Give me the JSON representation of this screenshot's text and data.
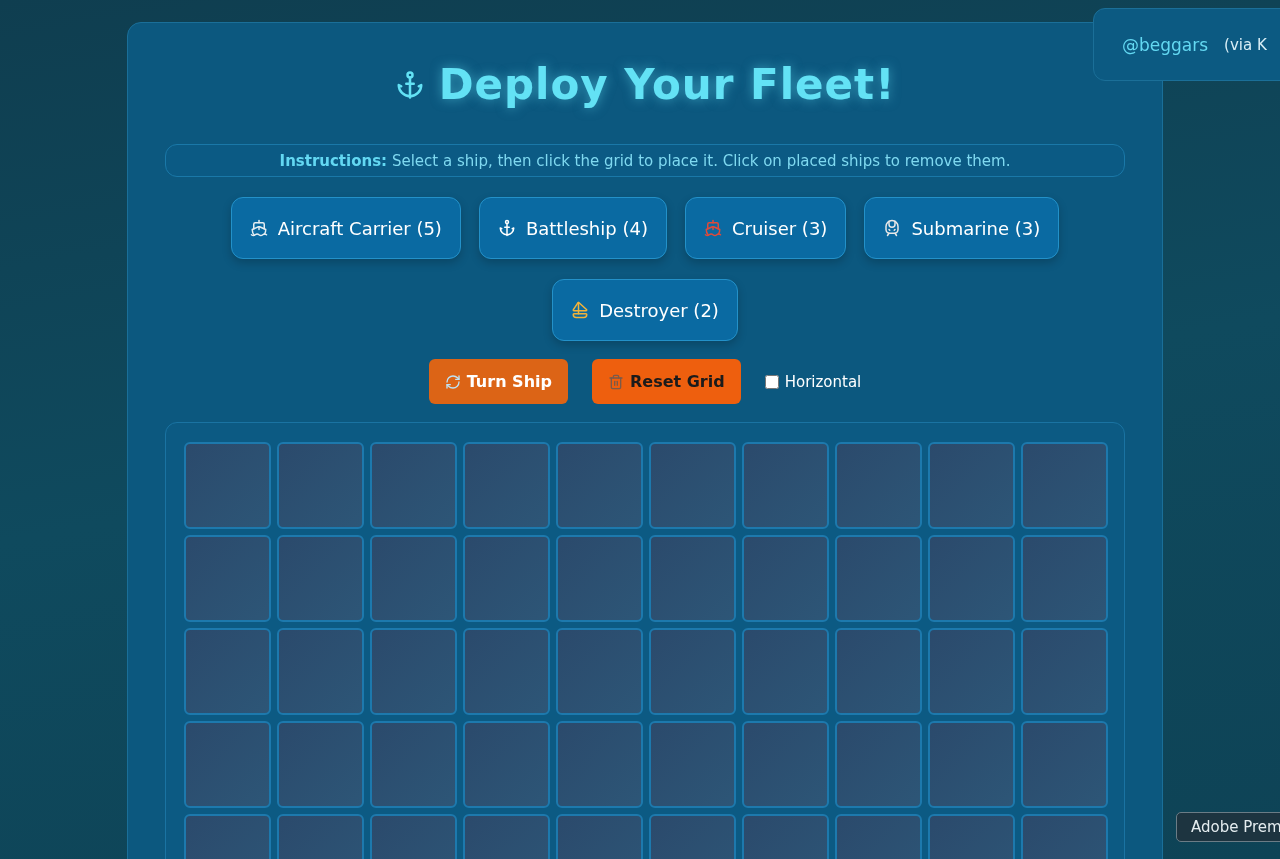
{
  "title": "Deploy Your Fleet!",
  "instructions": {
    "label": "Instructions:",
    "text": "Select a ship, then click the grid to place it. Click on placed ships to remove them."
  },
  "ships": [
    {
      "label": "Aircraft Carrier (5)",
      "selected": false
    },
    {
      "label": "Battleship (4)",
      "selected": false
    },
    {
      "label": "Cruiser (3)",
      "selected": false
    },
    {
      "label": "Submarine (3)",
      "selected": false
    },
    {
      "label": "Destroyer (2)",
      "selected": false
    }
  ],
  "actions": [
    {
      "label": "Turn Ship",
      "kind": "turn"
    },
    {
      "label": "Reset Grid",
      "kind": "reset"
    }
  ],
  "orientation": {
    "label": "Horizontal",
    "checked": false
  },
  "grid": {
    "rows": [
      [
        {
          "kind": "empty"
        },
        {
          "kind": "empty"
        },
        {
          "kind": "empty"
        },
        {
          "kind": "empty"
        },
        {
          "kind": "empty"
        },
        {
          "kind": "empty"
        },
        {
          "kind": "empty"
        },
        {
          "kind": "empty"
        },
        {
          "kind": "empty"
        },
        {
          "kind": "empty"
        }
      ],
      [
        {
          "kind": "empty"
        },
        {
          "kind": "empty"
        },
        {
          "kind": "empty"
        },
        {
          "kind": "empty"
        },
        {
          "kind": "empty"
        },
        {
          "kind": "empty"
        },
        {
          "kind": "empty"
        },
        {
          "kind": "empty"
        },
        {
          "kind": "empty"
        },
        {
          "kind": "empty"
        }
      ],
      [
        {
          "kind": "empty"
        },
        {
          "kind": "empty"
        },
        {
          "kind": "empty"
        },
        {
          "kind": "empty"
        },
        {
          "kind": "empty"
        },
        {
          "kind": "empty"
        },
        {
          "kind": "empty"
        },
        {
          "kind": "empty"
        },
        {
          "kind": "empty"
        },
        {
          "kind": "empty"
        }
      ],
      [
        {
          "kind": "empty"
        },
        {
          "kind": "empty"
        },
        {
          "kind": "empty"
        },
        {
          "kind": "empty"
        },
        {
          "kind": "empty"
        },
        {
          "kind": "empty"
        },
        {
          "kind": "empty"
        },
        {
          "kind": "empty"
        },
        {
          "kind": "empty"
        },
        {
          "kind": "empty"
        }
      ],
      [
        {
          "kind": "empty"
        },
        {
          "kind": "empty"
        },
        {
          "kind": "empty"
        },
        {
          "kind": "empty"
        },
        {
          "kind": "empty"
        },
        {
          "kind": "empty"
        },
        {
          "kind": "empty"
        },
        {
          "kind": "empty"
        },
        {
          "kind": "empty"
        },
        {
          "kind": "empty"
        }
      ]
    ]
  },
  "credit": {
    "handle": "@beggars",
    "via": "(via K"
  },
  "tooltip": "Adobe Prem"
}
